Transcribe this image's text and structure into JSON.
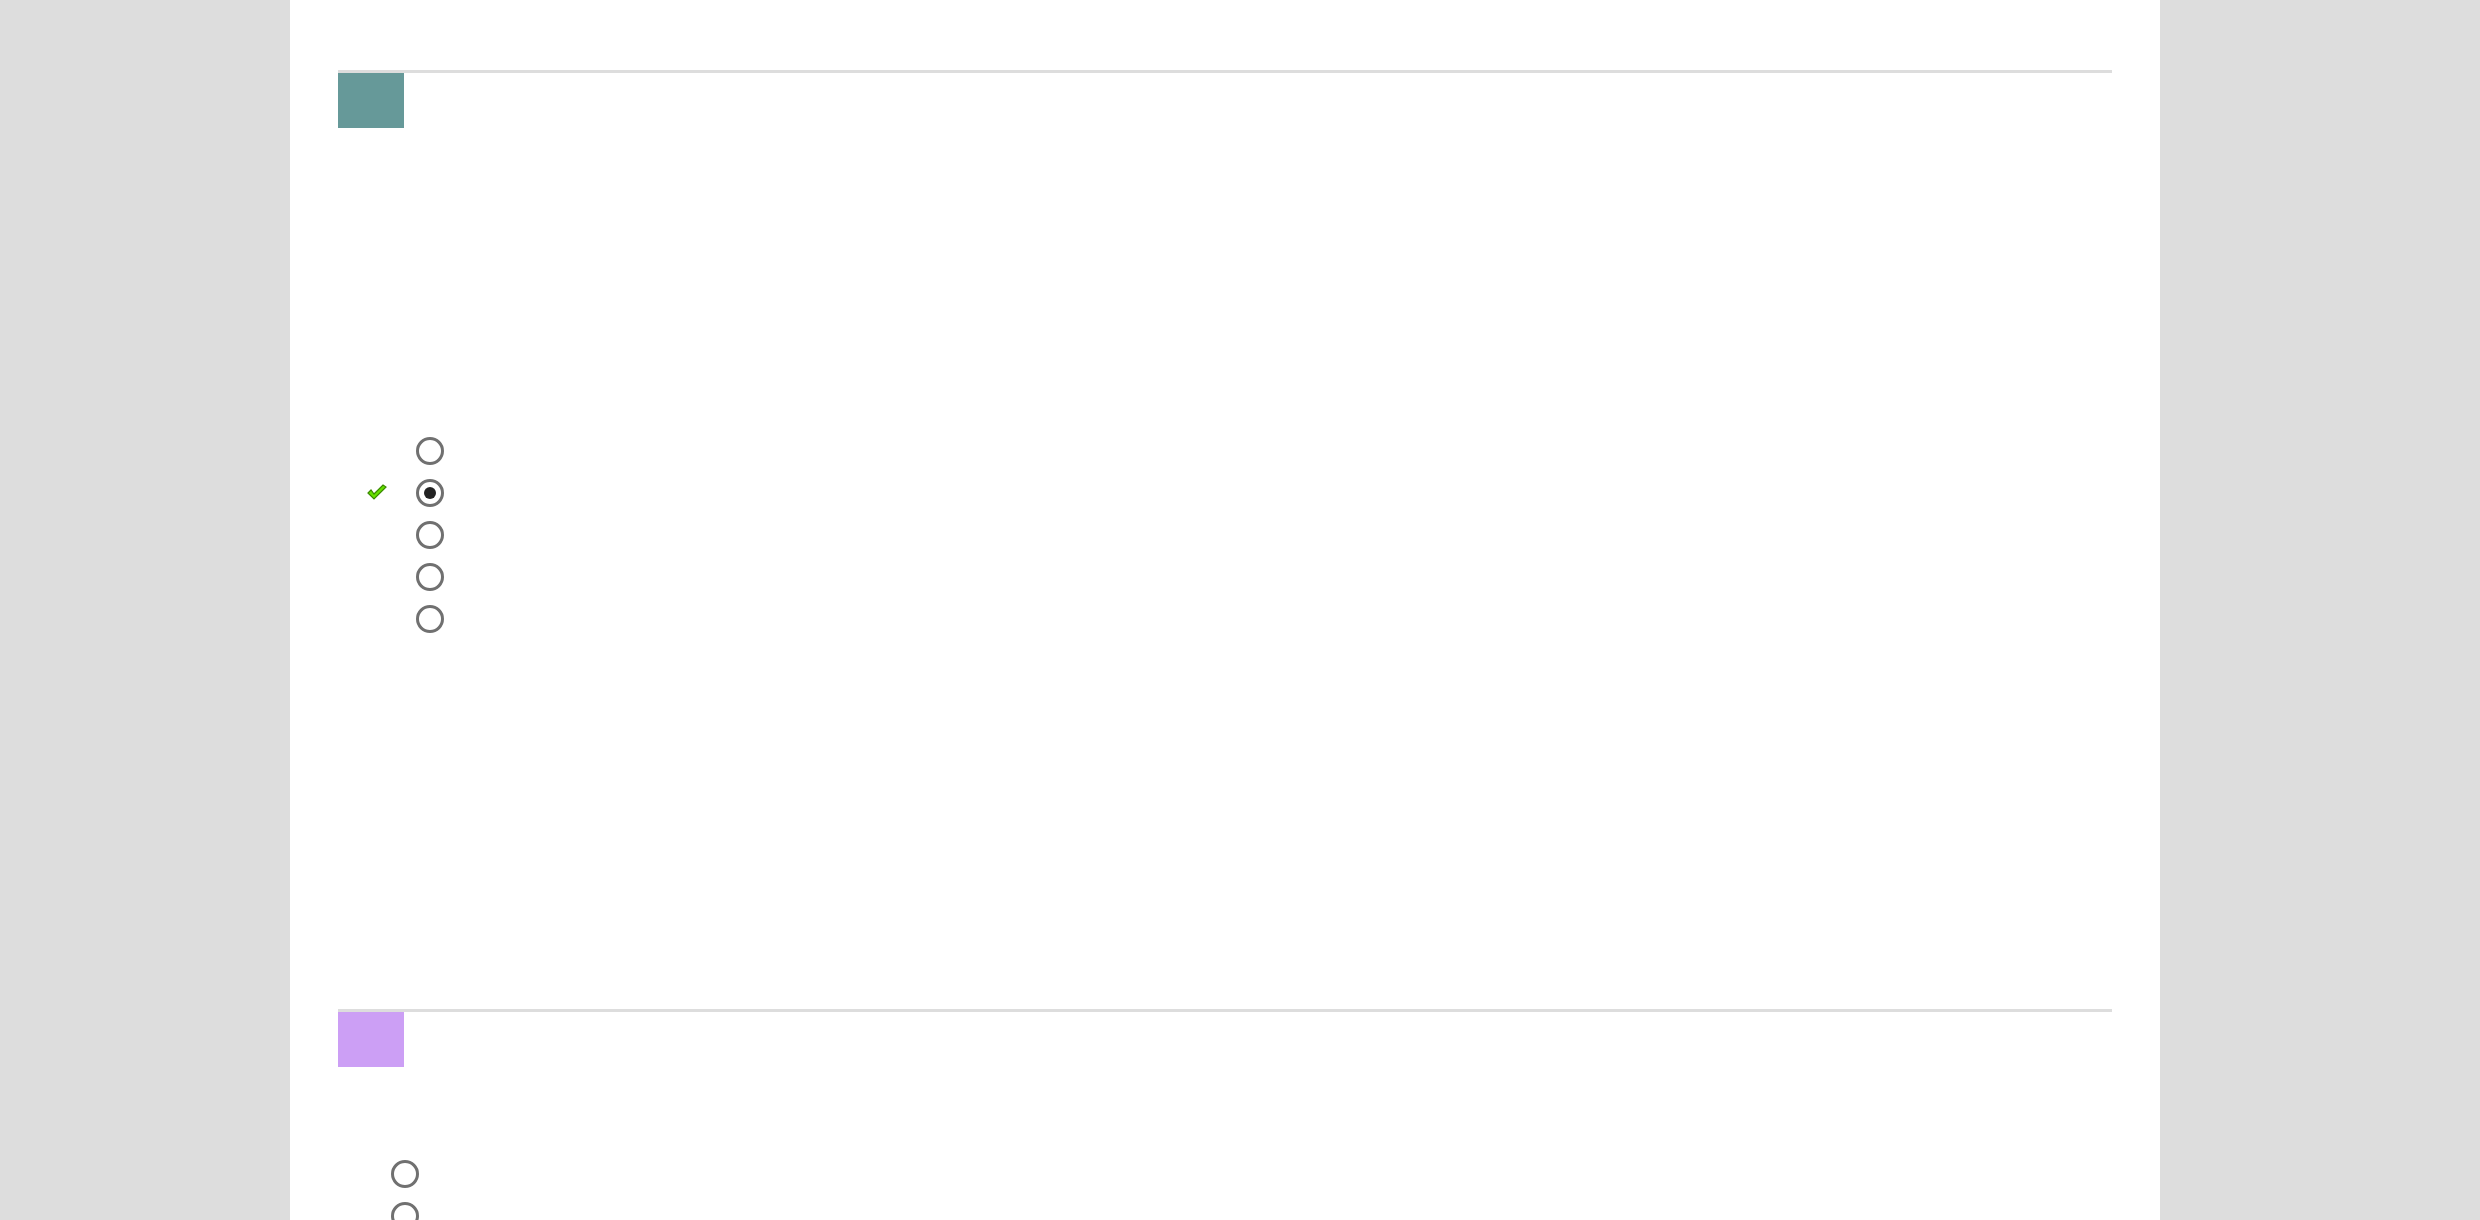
{
  "questions": [
    {
      "color": "#669999",
      "options": [
        {
          "selected": false,
          "correct": false
        },
        {
          "selected": true,
          "correct": true
        },
        {
          "selected": false,
          "correct": false
        },
        {
          "selected": false,
          "correct": false
        },
        {
          "selected": false,
          "correct": false
        }
      ]
    },
    {
      "color": "#cc9ff5",
      "options": [
        {
          "selected": false
        },
        {
          "selected": false
        }
      ]
    }
  ]
}
